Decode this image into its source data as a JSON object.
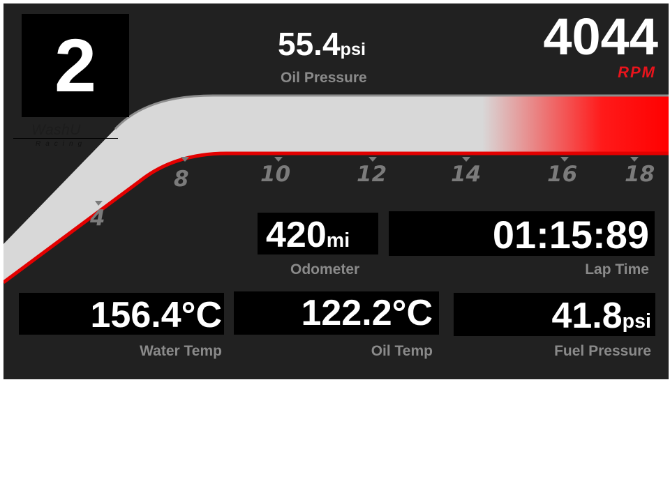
{
  "gear": "2",
  "logo": {
    "wordmark": "WashU",
    "subtitle": "Racing"
  },
  "oil_pressure": {
    "value": "55.4",
    "unit": "psi",
    "label": "Oil Pressure"
  },
  "rpm": {
    "value": "4044",
    "unit": "RPM"
  },
  "rpm_scale": {
    "ticks": [
      "4",
      "8",
      "10",
      "12",
      "14",
      "16",
      "18"
    ]
  },
  "odometer": {
    "value": "420",
    "unit": "mi",
    "label": "Odometer"
  },
  "lap_time": {
    "value": "01:15:89",
    "label": "Lap Time"
  },
  "water_temp": {
    "value": "156.4°C",
    "label": "Water Temp"
  },
  "oil_temp": {
    "value": "122.2°C",
    "label": "Oil Temp"
  },
  "fuel_pressure": {
    "value": "41.8",
    "unit": "psi",
    "label": "Fuel Pressure"
  },
  "colors": {
    "background": "#212121",
    "accent": "#ff0000",
    "gauge": "#d8d8d8",
    "label": "#8a8a8a"
  }
}
